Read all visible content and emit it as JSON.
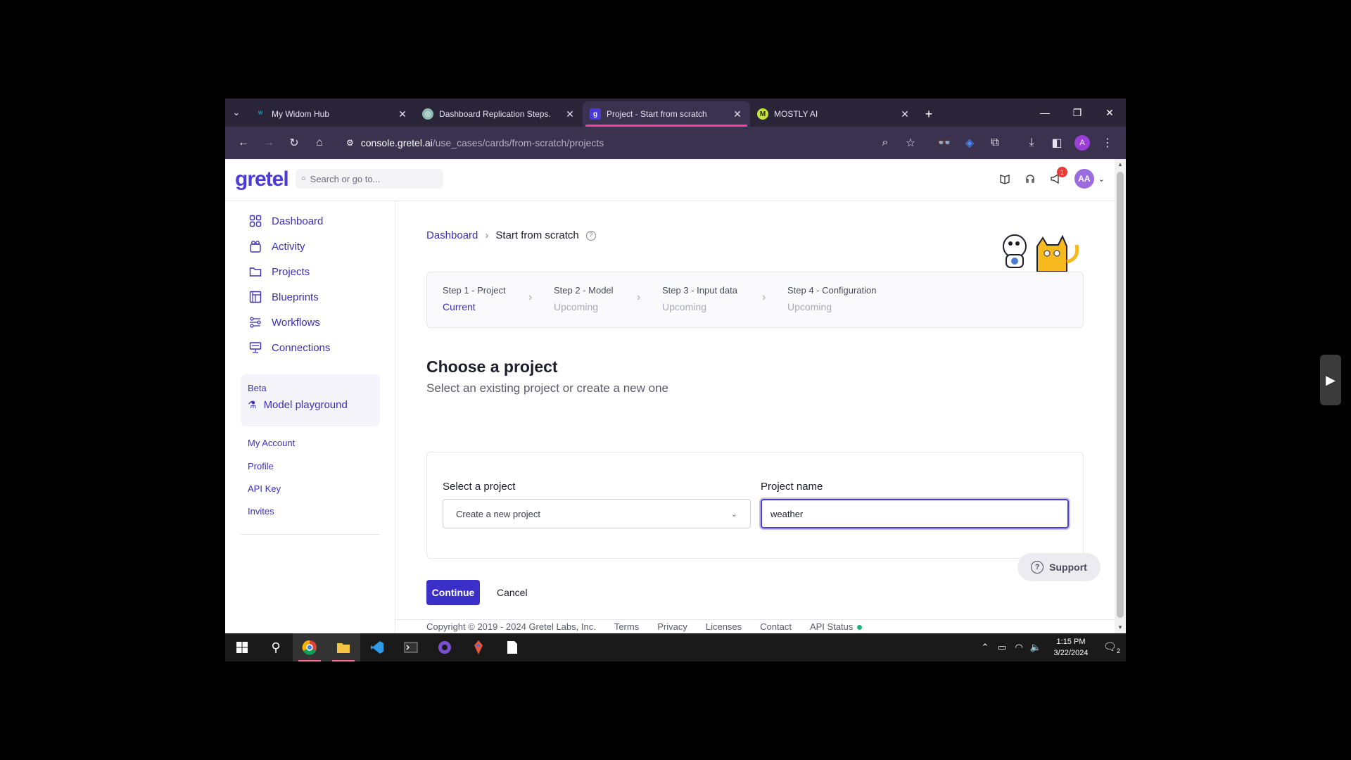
{
  "browser": {
    "tabs": [
      {
        "title": "My Widom Hub",
        "favicon": "W",
        "favicon_color": "#17a2b8"
      },
      {
        "title": "Dashboard Replication Steps.",
        "favicon": "◎",
        "favicon_color": "#8fbcb0"
      },
      {
        "title": "Project - Start from scratch",
        "favicon": "g",
        "favicon_color": "#4a3bd6"
      },
      {
        "title": "MOSTLY AI",
        "favicon": "M",
        "favicon_color": "#c6e636"
      }
    ],
    "url_host": "console.gretel.ai",
    "url_path": "/use_cases/cards/from-scratch/projects",
    "profile_initial": "A"
  },
  "app": {
    "logo": "gretel",
    "search_placeholder": "Search or go to...",
    "notification_count": "1",
    "user_initials": "AA"
  },
  "sidebar": {
    "items": [
      {
        "label": "Dashboard",
        "icon": "grid-icon"
      },
      {
        "label": "Activity",
        "icon": "activity-icon"
      },
      {
        "label": "Projects",
        "icon": "folder-icon"
      },
      {
        "label": "Blueprints",
        "icon": "blueprint-icon"
      },
      {
        "label": "Workflows",
        "icon": "workflow-icon"
      },
      {
        "label": "Connections",
        "icon": "connections-icon"
      }
    ],
    "beta_label": "Beta",
    "beta_link": "Model playground",
    "account_heading": "My Account",
    "account_links": [
      "Profile",
      "API Key",
      "Invites"
    ]
  },
  "breadcrumb": {
    "parent": "Dashboard",
    "current": "Start from scratch"
  },
  "steps": [
    {
      "title": "Step 1 - Project",
      "status": "Current"
    },
    {
      "title": "Step 2 - Model",
      "status": "Upcoming"
    },
    {
      "title": "Step 3 - Input data",
      "status": "Upcoming"
    },
    {
      "title": "Step 4 - Configuration",
      "status": "Upcoming"
    }
  ],
  "main": {
    "heading": "Choose a project",
    "subheading": "Select an existing project or create a new one",
    "select_label": "Select a project",
    "select_value": "Create a new project",
    "name_label": "Project name",
    "name_value": "weather",
    "continue_label": "Continue",
    "cancel_label": "Cancel",
    "support_label": "Support"
  },
  "footer": {
    "copyright": "Copyright © 2019 - 2024 Gretel Labs, Inc.",
    "links": [
      "Terms",
      "Privacy",
      "Licenses",
      "Contact",
      "API Status"
    ]
  },
  "taskbar": {
    "time": "1:15 PM",
    "date": "3/22/2024",
    "notification_count": "2"
  },
  "colors": {
    "accent": "#3b2fc9",
    "tab_indicator": "#ff3fa4",
    "status_ok": "#22b07d"
  }
}
